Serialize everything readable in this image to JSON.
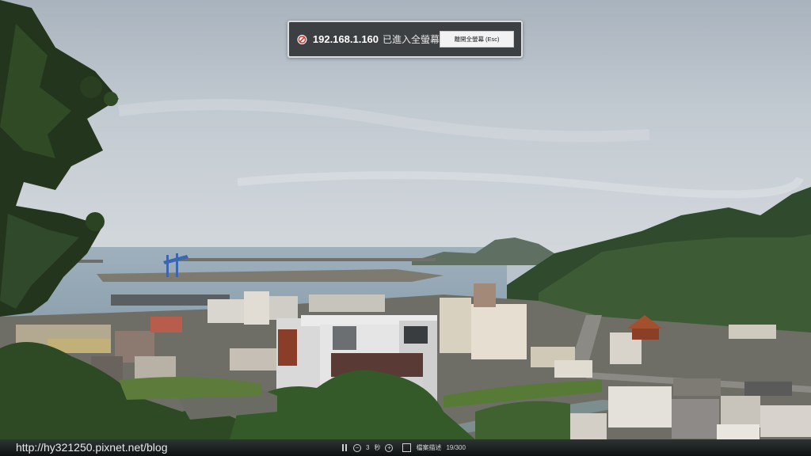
{
  "fullscreen_notice": {
    "host": "192.168.1.160",
    "message": "已進入全螢幕",
    "exit_button_label": "離開全螢幕 (Esc)"
  },
  "footer": {
    "watermark": "http://hy321250.pixnet.net/blog",
    "interval_value": "3",
    "interval_unit": "秒",
    "description_label": "檔案描述",
    "counter": "19/300"
  },
  "icons": {
    "notice_icon": "no-entry-icon",
    "pause": "pause-icon",
    "decrease": "minus-icon",
    "increase": "plus-icon",
    "description_toggle": "checkbox-icon"
  }
}
